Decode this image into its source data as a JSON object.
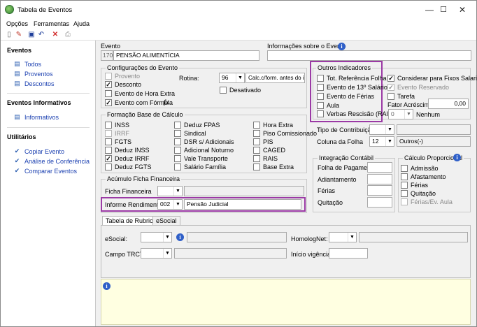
{
  "window": {
    "title": "Tabela de Eventos",
    "minimize": "—",
    "maximize": "☐",
    "close": "✕"
  },
  "menu": [
    "Opções",
    "Ferramentas",
    "Ajuda"
  ],
  "sidebar": {
    "eventos_title": "Eventos",
    "eventos": [
      "Todos",
      "Proventos",
      "Descontos"
    ],
    "informativos_title": "Eventos Informativos",
    "informativos": [
      "Informativos"
    ],
    "utilitarios_title": "Utilitários",
    "utilitarios": [
      "Copiar Evento",
      "Análise de Conferência",
      "Comparar Eventos"
    ]
  },
  "evento": {
    "label": "Evento",
    "code": "170",
    "name": "PENSÃO ALIMENTÍCIA",
    "info_label": "Informações sobre o Evento"
  },
  "config": {
    "title": "Configurações do Evento",
    "provento": "Provento",
    "desconto": "Desconto",
    "hora_extra": "Evento de Hora Extra",
    "formula": "Evento com Fórmula",
    "rotina_label": "Rotina:",
    "rotina_value": "96",
    "rotina_desc": "Calc.c/form. antes do irf",
    "desativado": "Desativado",
    "fx": "fx"
  },
  "formacao": {
    "title": "Formação Base de Cálculo",
    "col1": [
      "INSS",
      "IRRF",
      "FGTS",
      "Deduz INSS",
      "Deduz IRRF",
      "Deduz FGTS"
    ],
    "col2": [
      "Deduz FPAS",
      "Sindical",
      "DSR s/ Adicionais",
      "Adicional Noturno",
      "Vale Transporte",
      "Salário Família"
    ],
    "col3": [
      "Hora Extra",
      "Piso Comissionado",
      "PIS",
      "CAGED",
      "RAIS",
      "Base Extra"
    ]
  },
  "acumulo": {
    "title": "Acúmulo Ficha Financeira",
    "ficha_label": "Ficha Financeira",
    "informe_label": "Informe Rendimentos",
    "informe_code": "002",
    "informe_desc": "Pensão Judicial"
  },
  "outros": {
    "title": "Outros Indicadores",
    "left": [
      "Tot. Referência Folha",
      "Evento de 13º Salário",
      "Evento de Férias",
      "Aula",
      "Verbas Rescisão (RAIS)"
    ],
    "right": [
      "Considerar para Fixos Salariais",
      "Evento Reservado",
      "Tarefa"
    ],
    "fator_label": "Fator Acréscimo",
    "fator_value": "0,00",
    "nenhum_code": "0",
    "nenhum_label": "Nenhum"
  },
  "contrib": {
    "tipo_label": "Tipo de Contribuição",
    "coluna_label": "Coluna da Folha",
    "coluna_value": "12",
    "coluna_desc": "Outros(-)"
  },
  "integracao": {
    "title": "Integração Contábil",
    "items": [
      "Folha de Pagamento",
      "Adiantamento",
      "Férias",
      "Quitação"
    ]
  },
  "proporcional": {
    "title": "Cálculo Proporcional",
    "items": [
      "Admissão",
      "Afastamento",
      "Férias",
      "Quitação",
      "Férias/Ev. Aula"
    ]
  },
  "tabs": [
    "Tabela de Rubricas",
    "eSocial"
  ],
  "rubricas": {
    "esocial": "eSocial:",
    "homolognet": "HomologNet:",
    "trct": "Campo TRCT:",
    "vigencia": "Início vigência:"
  },
  "info_glyph": "i",
  "colors": {
    "highlight": "#9b3aa5",
    "link": "#1a3fb0",
    "notes_bg": "#ffffe1"
  }
}
